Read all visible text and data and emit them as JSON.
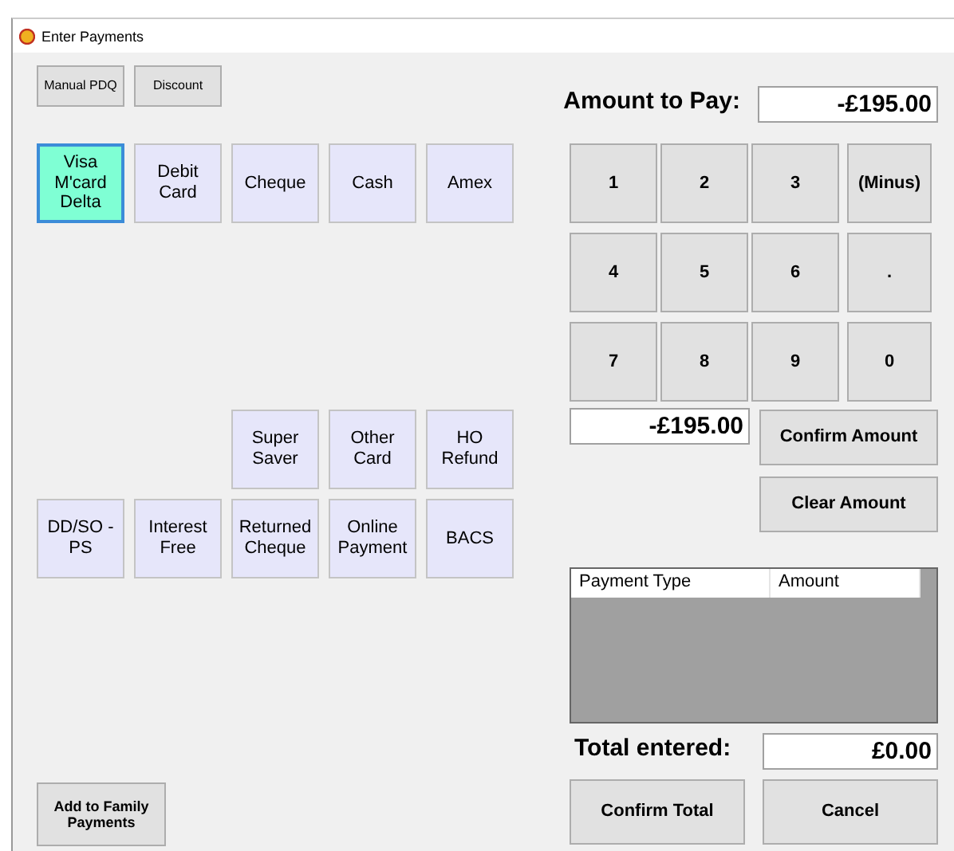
{
  "window": {
    "title": "Enter Payments"
  },
  "top_buttons": [
    "Manual PDQ",
    "Discount"
  ],
  "amount_to_pay": {
    "label": "Amount to Pay:",
    "value": "-£195.00"
  },
  "payment_types_top": [
    {
      "label": "Visa\nM'card\nDelta",
      "selected": true
    },
    {
      "label": "Debit\nCard",
      "selected": false
    },
    {
      "label": "Cheque",
      "selected": false
    },
    {
      "label": "Cash",
      "selected": false
    },
    {
      "label": "Amex",
      "selected": false
    }
  ],
  "payment_types_bottom": [
    [
      {
        "label": "Super\nSaver",
        "selected": false
      },
      {
        "label": "Other\nCard",
        "selected": false
      },
      {
        "label": "HO\nRefund",
        "selected": false
      }
    ],
    [
      {
        "label": "DD/SO -\nPS",
        "selected": false
      },
      {
        "label": "Interest\nFree",
        "selected": false
      },
      {
        "label": "Returned\nCheque",
        "selected": false
      },
      {
        "label": "Online\nPayment",
        "selected": false
      },
      {
        "label": "BACS",
        "selected": false
      }
    ]
  ],
  "family_button": "Add to Family\nPayments",
  "keypad": [
    "1",
    "2",
    "3",
    "(Minus)",
    "4",
    "5",
    "6",
    ".",
    "7",
    "8",
    "9",
    "0"
  ],
  "entered_amount": "-£195.00",
  "amount_buttons": [
    "Confirm Amount",
    "Clear Amount"
  ],
  "table": {
    "columns": [
      "Payment Type",
      "Amount"
    ]
  },
  "total": {
    "label": "Total entered:",
    "value": "£0.00"
  },
  "bottom_buttons": [
    "Confirm Total",
    "Cancel"
  ]
}
